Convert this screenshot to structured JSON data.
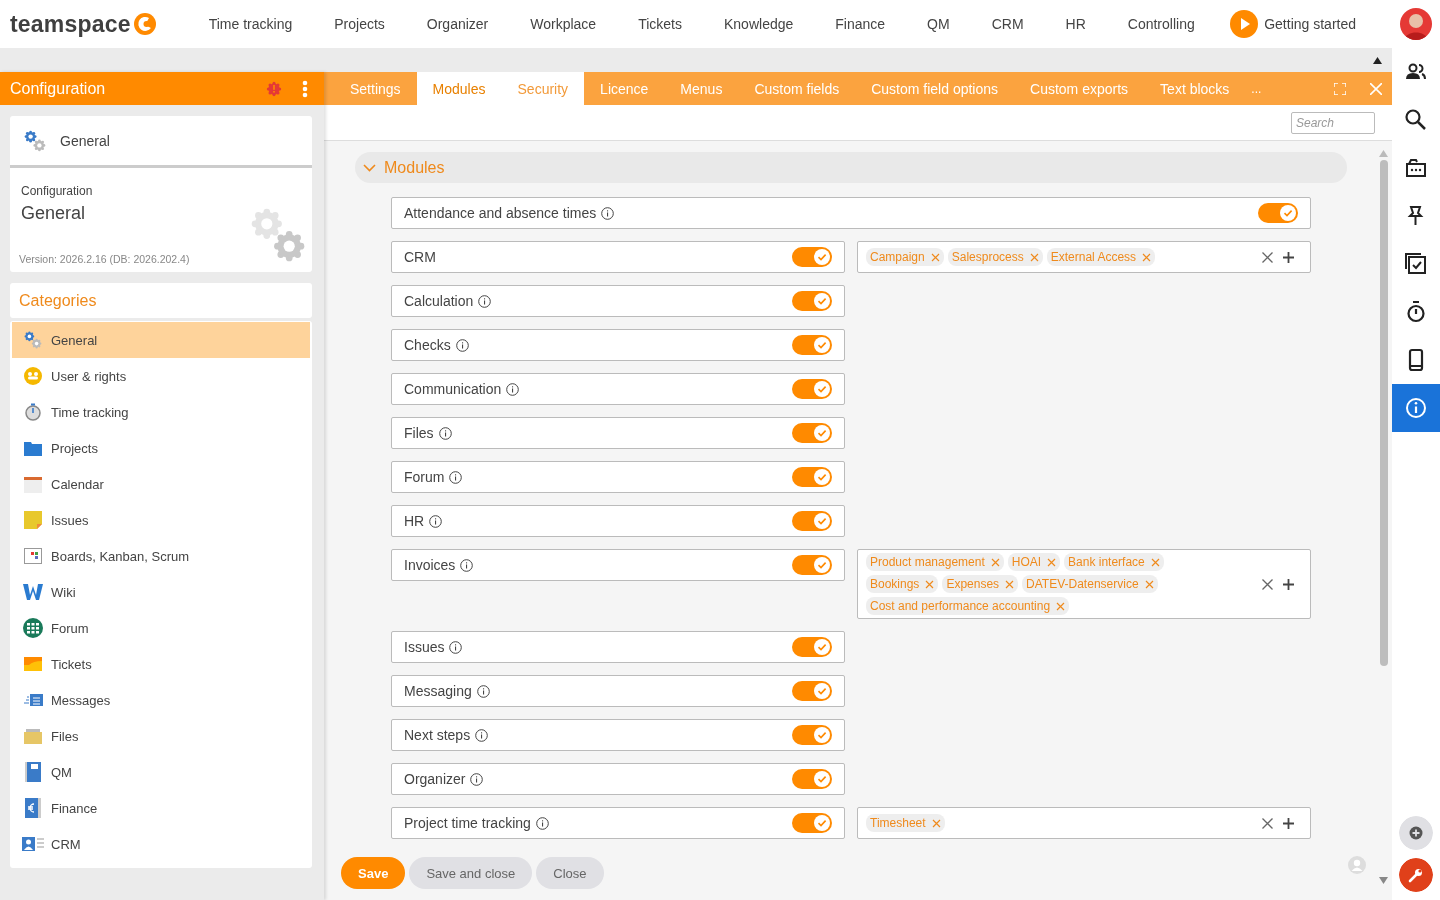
{
  "topnav": {
    "logo": "teamspace",
    "items": [
      "Time tracking",
      "Projects",
      "Organizer",
      "Workplace",
      "Tickets",
      "Knowledge",
      "Finance",
      "QM",
      "CRM",
      "HR",
      "Controlling"
    ],
    "getting_started": "Getting started"
  },
  "left_panel": {
    "title": "Configuration",
    "current": {
      "label": "General"
    },
    "info": {
      "caption": "Configuration",
      "title": "General",
      "version": "Version: 2026.2.16 (DB: 2026.202.4)"
    },
    "categories_title": "Categories",
    "categories": [
      {
        "label": "General",
        "selected": true
      },
      {
        "label": "User & rights",
        "selected": false
      },
      {
        "label": "Time tracking",
        "selected": false
      },
      {
        "label": "Projects",
        "selected": false
      },
      {
        "label": "Calendar",
        "selected": false
      },
      {
        "label": "Issues",
        "selected": false
      },
      {
        "label": "Boards, Kanban, Scrum",
        "selected": false
      },
      {
        "label": "Wiki",
        "selected": false
      },
      {
        "label": "Forum",
        "selected": false
      },
      {
        "label": "Tickets",
        "selected": false
      },
      {
        "label": "Messages",
        "selected": false
      },
      {
        "label": "Files",
        "selected": false
      },
      {
        "label": "QM",
        "selected": false
      },
      {
        "label": "Finance",
        "selected": false
      },
      {
        "label": "CRM",
        "selected": false
      }
    ]
  },
  "tabs": [
    {
      "label": "Settings",
      "selected": false,
      "hovered": false
    },
    {
      "label": "Modules",
      "selected": true,
      "hovered": false
    },
    {
      "label": "Security",
      "selected": false,
      "hovered": true
    },
    {
      "label": "Licence",
      "selected": false,
      "hovered": false
    },
    {
      "label": "Menus",
      "selected": false,
      "hovered": false
    },
    {
      "label": "Custom fields",
      "selected": false,
      "hovered": false
    },
    {
      "label": "Custom field options",
      "selected": false,
      "hovered": false
    },
    {
      "label": "Custom exports",
      "selected": false,
      "hovered": false
    },
    {
      "label": "Text blocks",
      "selected": false,
      "hovered": false
    }
  ],
  "tabs_more": "...",
  "search": {
    "placeholder": "Search"
  },
  "section": {
    "title": "Modules",
    "expanded": true
  },
  "modules": [
    {
      "kind": "wide",
      "label": "Attendance and absence times",
      "info": true,
      "on": true
    },
    {
      "kind": "split",
      "label": "CRM",
      "info": false,
      "on": true,
      "tags": [
        "Campaign",
        "Salesprocess",
        "External Access"
      ]
    },
    {
      "kind": "split",
      "label": "Calculation",
      "info": true,
      "on": true
    },
    {
      "kind": "split",
      "label": "Checks",
      "info": true,
      "on": true
    },
    {
      "kind": "split",
      "label": "Communication",
      "info": true,
      "on": true
    },
    {
      "kind": "split",
      "label": "Files",
      "info": true,
      "on": true
    },
    {
      "kind": "split",
      "label": "Forum",
      "info": true,
      "on": true
    },
    {
      "kind": "split",
      "label": "HR",
      "info": true,
      "on": true
    },
    {
      "kind": "split",
      "label": "Invoices",
      "info": true,
      "on": true,
      "tags": [
        "Product management",
        "HOAI",
        "Bank interface",
        "Bookings",
        "Expenses",
        "DATEV-Datenservice",
        "Cost and performance accounting"
      ]
    },
    {
      "kind": "split",
      "label": "Issues",
      "info": true,
      "on": true
    },
    {
      "kind": "split",
      "label": "Messaging",
      "info": true,
      "on": true
    },
    {
      "kind": "split",
      "label": "Next steps",
      "info": true,
      "on": true
    },
    {
      "kind": "split",
      "label": "Organizer",
      "info": true,
      "on": true
    },
    {
      "kind": "split",
      "label": "Project time tracking",
      "info": true,
      "on": true,
      "tags": [
        "Timesheet"
      ]
    }
  ],
  "buttons": [
    {
      "kind": "primary",
      "label": "Save"
    },
    {
      "kind": "secondary",
      "label": "Save and close"
    },
    {
      "kind": "secondary",
      "label": "Close"
    }
  ],
  "right_toolbar": [
    {
      "selected": false
    },
    {
      "selected": false
    },
    {
      "selected": false
    },
    {
      "selected": false
    },
    {
      "selected": false
    },
    {
      "selected": false
    },
    {
      "selected": false
    },
    {
      "selected": true
    }
  ]
}
